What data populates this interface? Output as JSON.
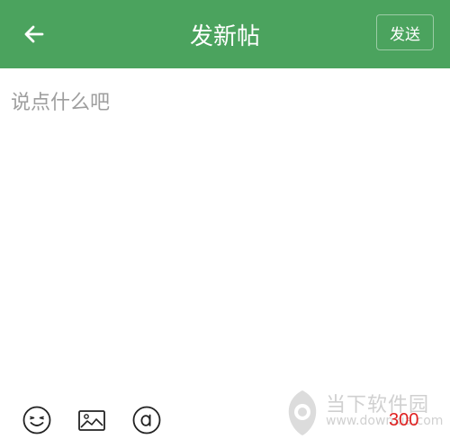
{
  "header": {
    "title": "发新帖",
    "send_label": "发送",
    "back_icon": "arrow-left-icon",
    "bg_color": "#4ba35e"
  },
  "editor": {
    "placeholder": "说点什么吧",
    "value": ""
  },
  "toolbar": {
    "icons": [
      "emoji-icon",
      "image-icon",
      "at-icon"
    ],
    "char_count": "300",
    "char_count_color": "#e02020"
  },
  "watermark": {
    "text": "当下软件园",
    "url": "www.downxia.com"
  }
}
